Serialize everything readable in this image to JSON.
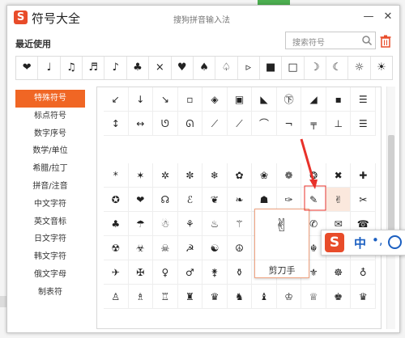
{
  "window": {
    "logo_letter": "S",
    "title": "符号大全",
    "ime_name": "搜狗拼音输入法",
    "min_glyph": "—",
    "close_glyph": "✕"
  },
  "recent": {
    "label": "最近使用",
    "search_placeholder": "搜索符号",
    "symbols": [
      "❤",
      "♩",
      "♫",
      "♬",
      "♪",
      "♣",
      "×",
      "♥",
      "♠",
      "♤",
      "▹",
      "■",
      "□",
      "☽",
      "☾",
      "☼",
      "☀"
    ]
  },
  "sidebar": {
    "active_index": 0,
    "items": [
      "特殊符号",
      "标点符号",
      "数字序号",
      "数学/单位",
      "希腊/拉丁",
      "拼音/注音",
      "中文字符",
      "英文音标",
      "日文字符",
      "韩文字符",
      "俄文字母",
      "制表符"
    ]
  },
  "grid_top": [
    "↙",
    "↓",
    "↘",
    "▫",
    "◈",
    "▣",
    "◣",
    "㊦",
    "◢",
    "▪",
    "☰",
    "↕",
    "↔",
    "ᘎ",
    "ᘏ",
    "⟋",
    "⟋",
    "⌒",
    "¬",
    "╤",
    "⊥",
    "☰"
  ],
  "grid_main": [
    "*",
    "✶",
    "✲",
    "✼",
    "❄",
    "✿",
    "❀",
    "❁",
    "❂",
    "✖",
    "✚",
    "✪",
    "❤",
    "☊",
    "ℰ",
    "❦",
    "❧",
    "☗",
    "✑",
    "✎",
    "✌",
    "✂",
    "♣",
    "☂",
    "☃",
    "⚘",
    "♨",
    "⚚",
    "↰",
    "♨",
    "✆",
    "✉",
    "☎",
    "☢",
    "☣",
    "☠",
    "☭",
    "☯",
    "☮",
    "☸",
    "✡",
    "☬",
    "⚙",
    "⚚",
    "✈",
    "✠",
    "♀",
    "♂",
    "⚵",
    "⚱",
    "☥",
    "☤",
    "⚜",
    "☸",
    "♁",
    "♙",
    "♗",
    "♖",
    "♜",
    "♛",
    "♞",
    "♝",
    "♔",
    "♕",
    "♚",
    "♛"
  ],
  "popup": {
    "glyph": "✌",
    "name": "剪刀手"
  },
  "ime_bar": {
    "logo": "S",
    "lang": "中",
    "punct": "•,"
  },
  "colors": {
    "accent": "#f06624",
    "ime_blue": "#1b5fc1",
    "arrow": "#e8312a"
  }
}
